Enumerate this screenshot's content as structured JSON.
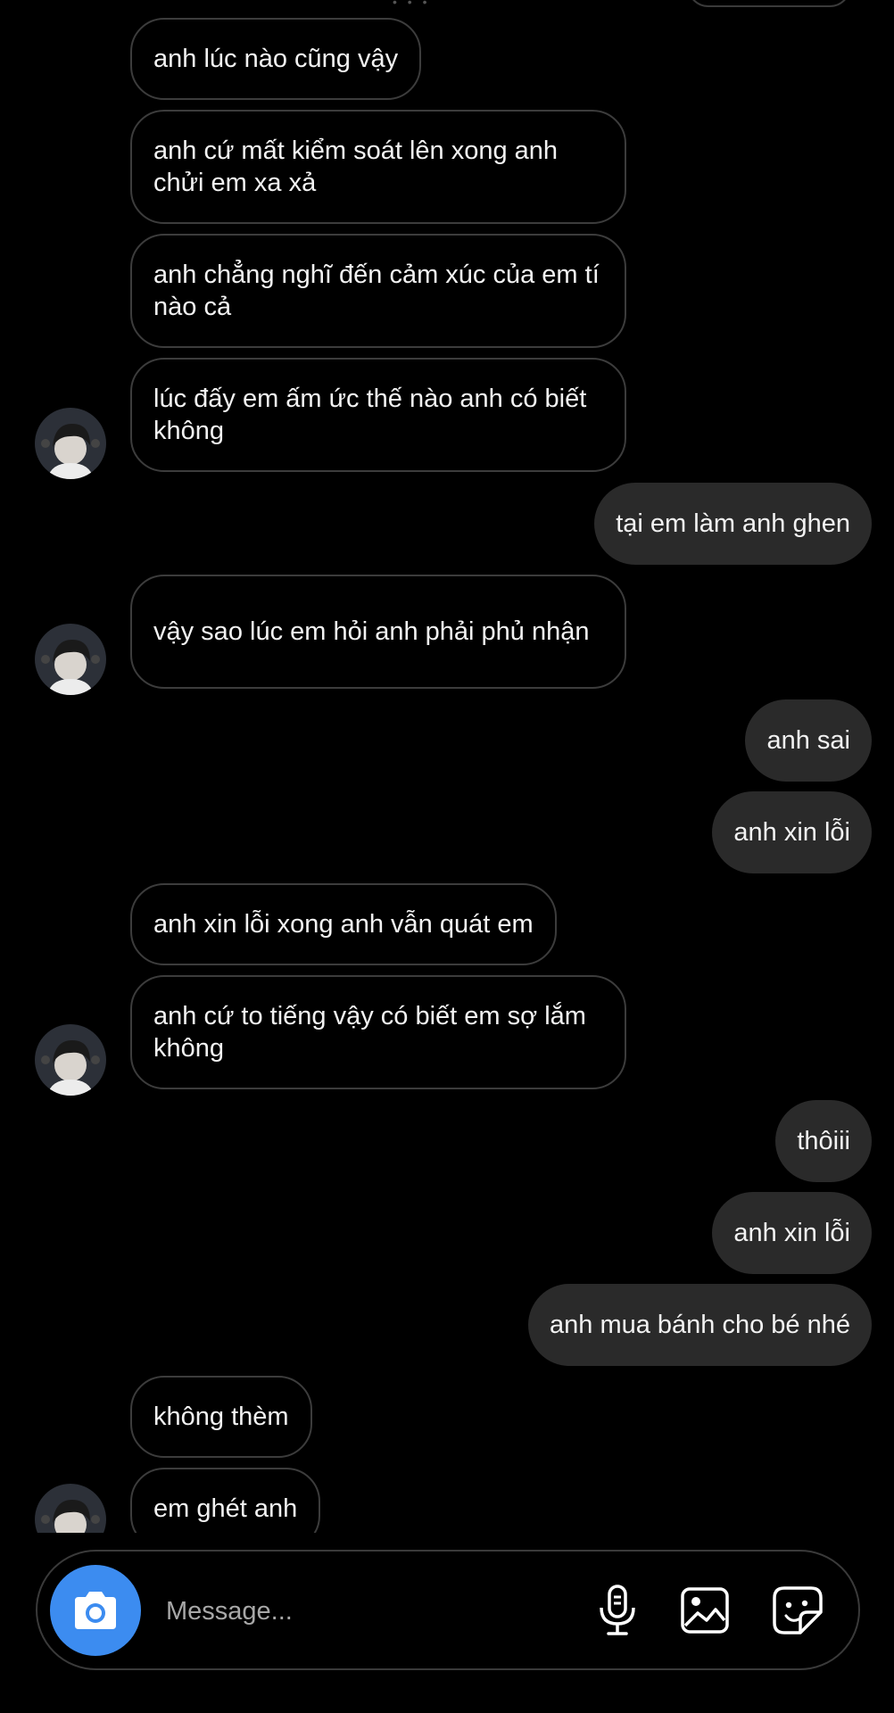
{
  "messages": [
    {
      "side": "in",
      "text": "anh lúc nào cũng vậy"
    },
    {
      "side": "in",
      "text": "anh cứ mất kiểm soát lên xong anh chửi em xa xả"
    },
    {
      "side": "in",
      "text": "anh chẳng nghĩ đến cảm xúc của em tí nào cả"
    },
    {
      "side": "in",
      "text": "lúc đấy em ấm ức thế nào anh có biết không"
    },
    {
      "side": "out",
      "text": "tại em làm anh ghen"
    },
    {
      "side": "in",
      "text": "vậy sao lúc em hỏi anh phải phủ nhận"
    },
    {
      "side": "out",
      "text": "anh sai"
    },
    {
      "side": "out",
      "text": "anh xin lỗi"
    },
    {
      "side": "in",
      "text": "anh xin lỗi xong anh vẫn quát em"
    },
    {
      "side": "in",
      "text": "anh cứ to tiếng vậy có biết em sợ lắm không"
    },
    {
      "side": "out",
      "text": "thôiii"
    },
    {
      "side": "out",
      "text": "anh xin lỗi"
    },
    {
      "side": "out",
      "text": "anh mua bánh cho bé nhé"
    },
    {
      "side": "in",
      "text": "không thèm"
    },
    {
      "side": "in",
      "text": "em ghét anh"
    }
  ],
  "composer": {
    "placeholder": "Message...",
    "icons": [
      "camera-icon",
      "microphone-icon",
      "gallery-icon",
      "sticker-icon"
    ],
    "camera_color": "#3c8cf0"
  },
  "colors": {
    "background": "#000000",
    "incoming_border": "#3c3c3c",
    "outgoing_bubble": "#2a2a2a"
  }
}
